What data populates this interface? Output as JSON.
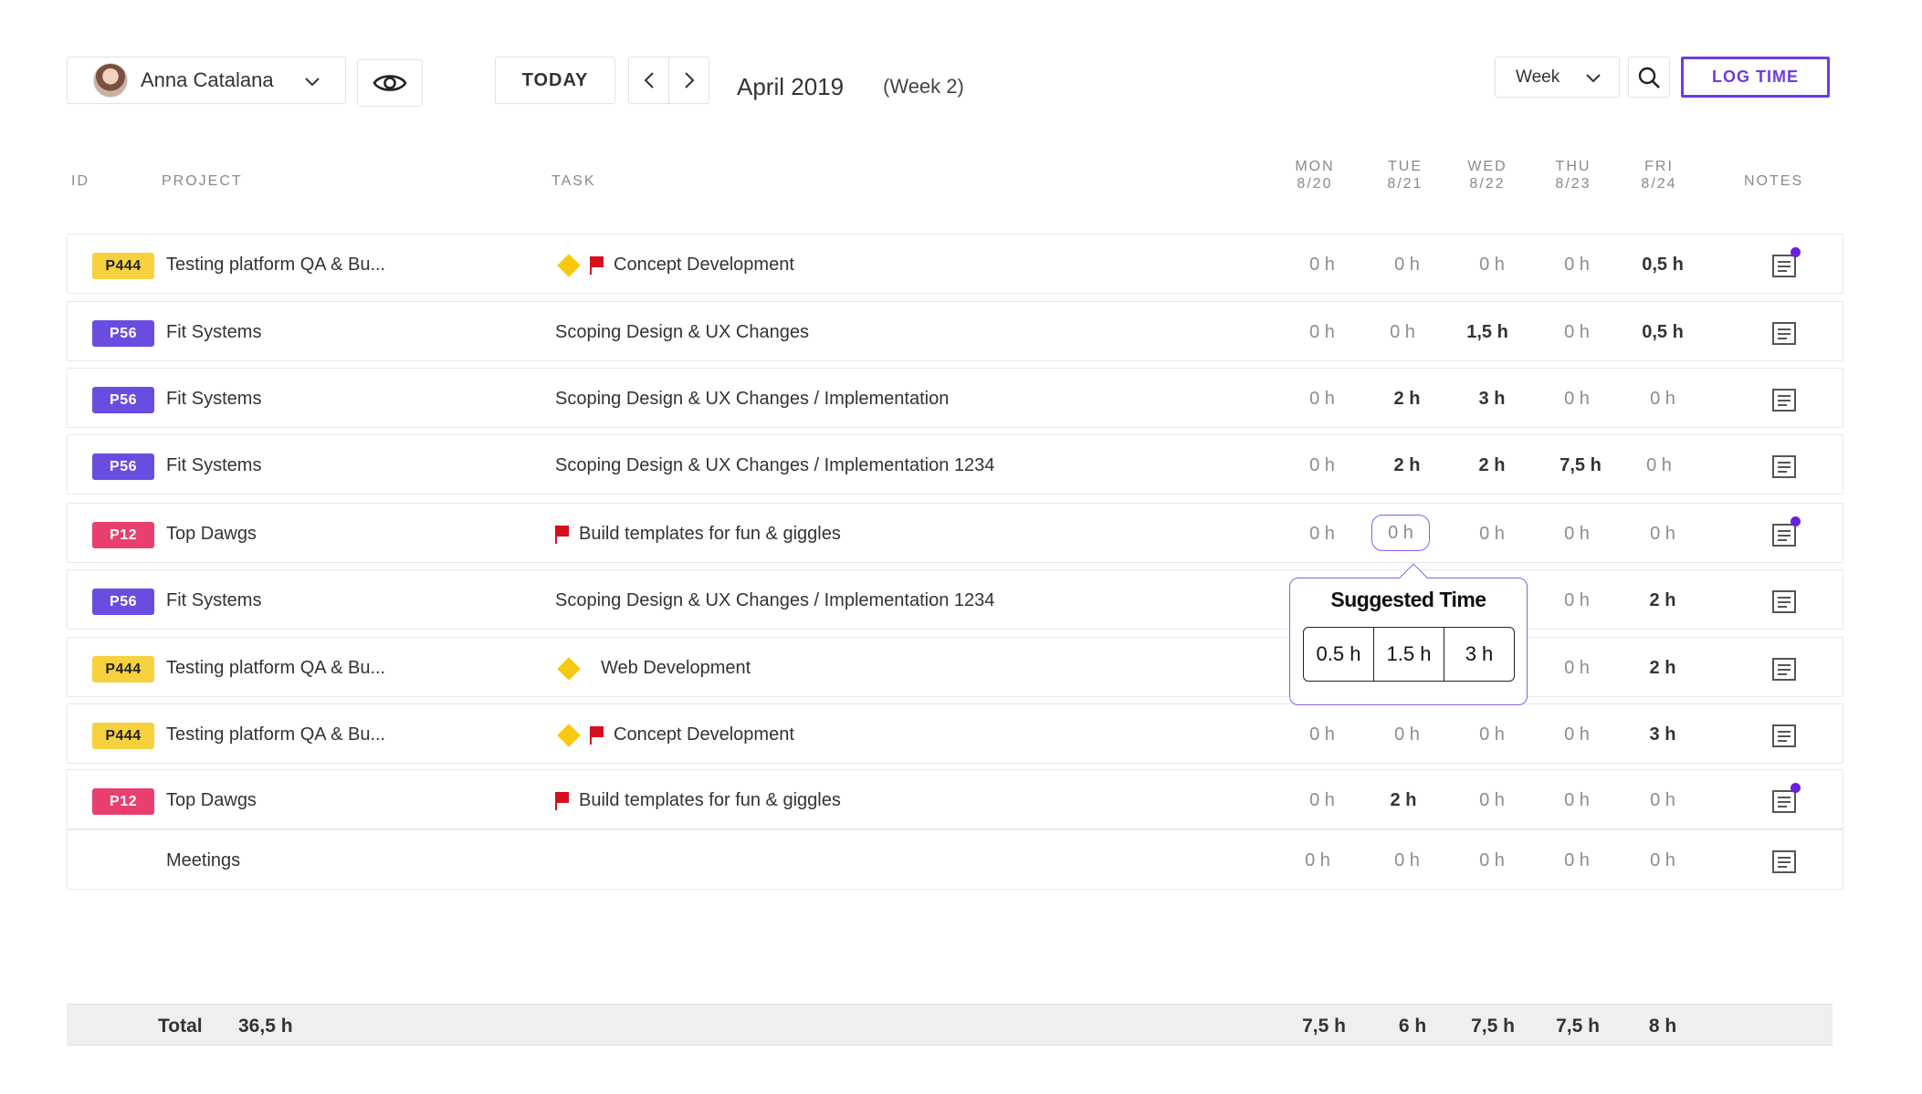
{
  "toolbar": {
    "user_name": "Anna Catalana",
    "today_label": "TODAY",
    "month": "April 2019",
    "week": "(Week 2)",
    "view": "Week",
    "log_time_label": "LOG TIME"
  },
  "headers": {
    "id": "ID",
    "project": "PROJECT",
    "task": "TASK",
    "days": [
      {
        "day": "MON",
        "date": "8/20"
      },
      {
        "day": "TUE",
        "date": "8/21"
      },
      {
        "day": "WED",
        "date": "8/22"
      },
      {
        "day": "THU",
        "date": "8/23"
      },
      {
        "day": "FRI",
        "date": "8/24"
      }
    ],
    "notes": "NOTES"
  },
  "rows": [
    {
      "id": "P444",
      "project": "Testing platform QA & Bu...",
      "task": "Concept Development",
      "hours": [
        "0 h",
        "0 h",
        "0 h",
        "0 h",
        "0,5 h"
      ]
    },
    {
      "id": "P56",
      "project": "Fit Systems",
      "task": "Scoping Design & UX Changes",
      "hours": [
        "0 h",
        "0 h",
        "1,5 h",
        "0 h",
        "0,5 h"
      ]
    },
    {
      "id": "P56",
      "project": "Fit Systems",
      "task": "Scoping Design & UX Changes / Implementation",
      "hours": [
        "0 h",
        "2 h",
        "3 h",
        "0 h",
        "0 h"
      ]
    },
    {
      "id": "P56",
      "project": "Fit Systems",
      "task": "Scoping Design & UX Changes / Implementation 1234",
      "hours": [
        "0 h",
        "2 h",
        "2 h",
        "7,5 h",
        "0 h"
      ]
    },
    {
      "id": "P12",
      "project": "Top Dawgs",
      "task": "Build templates for fun & giggles",
      "hours": [
        "0 h",
        "0 h",
        "0 h",
        "0 h",
        "0 h"
      ]
    },
    {
      "id": "P56",
      "project": "Fit Systems",
      "task": "Scoping Design & UX Changes / Implementation 1234",
      "hours": [
        "",
        "",
        "",
        "0 h",
        "2 h"
      ]
    },
    {
      "id": "P444",
      "project": "Testing platform QA & Bu...",
      "task": "Web Development",
      "hours": [
        "",
        "",
        "",
        "0 h",
        "2 h"
      ]
    },
    {
      "id": "P444",
      "project": "Testing platform QA & Bu...",
      "task": "Concept Development",
      "hours": [
        "0 h",
        "0 h",
        "0 h",
        "0 h",
        "3 h"
      ]
    },
    {
      "id": "P12",
      "project": "Top Dawgs",
      "task": "Build templates for fun & giggles",
      "hours": [
        "0 h",
        "2 h",
        "0 h",
        "0 h",
        "0 h"
      ]
    },
    {
      "id": "",
      "project": "Meetings",
      "task": "",
      "hours": [
        "0 h",
        "0 h",
        "0 h",
        "0 h",
        "0 h"
      ]
    }
  ],
  "tooltip": {
    "title": "Suggested Time",
    "options": [
      "0.5 h",
      "1.5 h",
      "3 h"
    ]
  },
  "totals": {
    "label": "Total",
    "value": "36,5 h",
    "days": [
      "7,5 h",
      "6 h",
      "7,5 h",
      "7,5 h",
      "8 h"
    ]
  },
  "colors": {
    "accent": "#6f3ce0",
    "badge_yellow": "#f7d23e",
    "badge_purple": "#6a4de0",
    "badge_red": "#e83f6f",
    "flag_red": "#d60f1f",
    "diamond_yellow": "#f6c90e"
  },
  "icons": {
    "eye": "eye-icon",
    "search": "search-icon",
    "notes": "notes-icon",
    "flag": "flag-icon",
    "diamond": "diamond-icon"
  }
}
